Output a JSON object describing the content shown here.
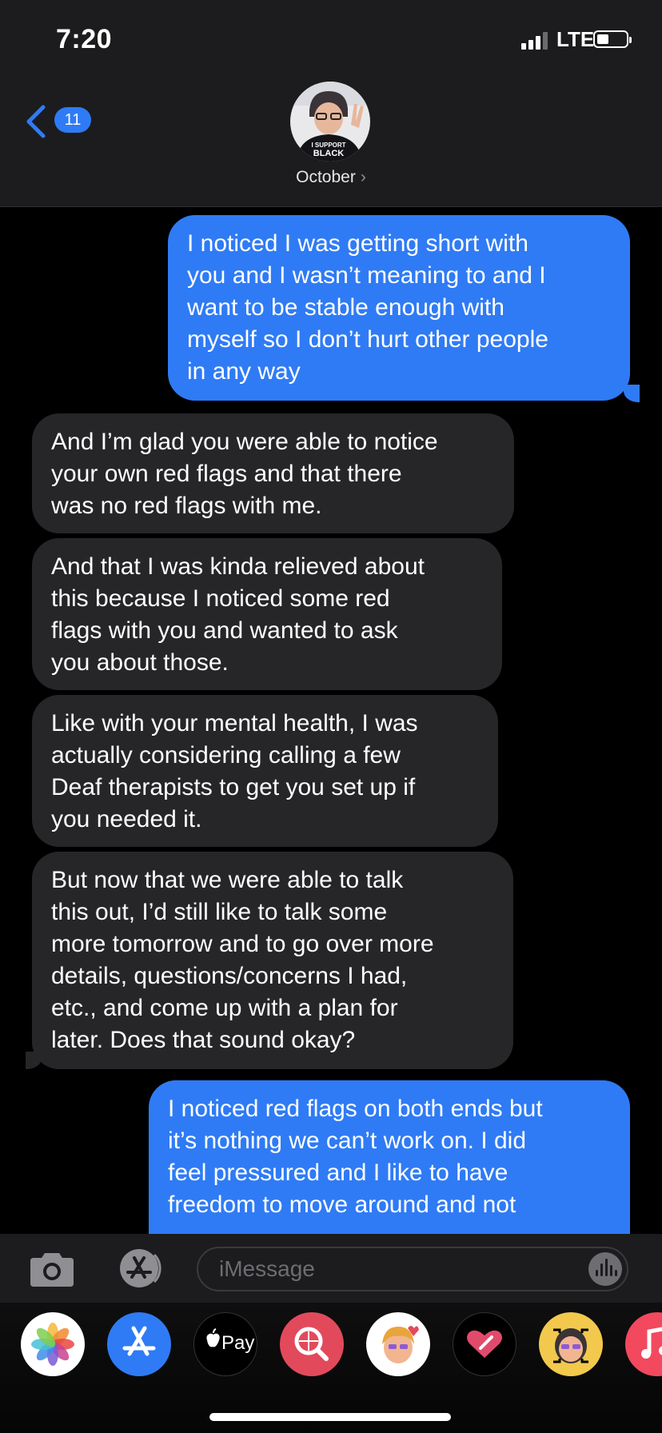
{
  "status_bar": {
    "time": "7:20",
    "network": "LTE",
    "signal_bars": 3,
    "signal_total": 4,
    "battery_level_percent": 30
  },
  "nav": {
    "back_count": "11",
    "contact_name": "October",
    "chevron": "›",
    "avatar_icon": "contact-photo",
    "avatar_shirt_text": "I SUPPORT BLACK"
  },
  "messages": [
    {
      "direction": "outgoing",
      "lines": [
        "I noticed I was getting short with",
        "you and I wasn’t meaning to and I",
        "want to be stable enough with",
        "myself so I don’t hurt other people",
        "in any way"
      ]
    },
    {
      "direction": "incoming",
      "lines": [
        "And I’m glad you were able to notice",
        "your own red flags and that there",
        "was no red flags with me."
      ]
    },
    {
      "direction": "incoming",
      "lines": [
        "And that I was kinda relieved about",
        "this because I noticed some red",
        "flags with you and wanted to ask",
        "you about those."
      ]
    },
    {
      "direction": "incoming",
      "lines": [
        "Like with your mental health, I was",
        "actually considering calling a few",
        "Deaf therapists to get you set up if",
        "you needed it."
      ]
    },
    {
      "direction": "incoming",
      "lines": [
        "But now that we were able to talk",
        "this out, I’d still like to talk some",
        "more tomorrow and to go over more",
        "details, questions/concerns I had,",
        "etc., and come up with a plan for",
        "later. Does that sound okay?"
      ]
    },
    {
      "direction": "outgoing",
      "lines": [
        "I noticed red flags on both ends but",
        "it’s nothing we can’t work on. I did",
        "feel pressured and I like to have",
        "freedom to move around and not"
      ]
    }
  ],
  "composer": {
    "placeholder": "iMessage",
    "camera_icon": "camera-icon",
    "apps_icon": "app-store-icon",
    "audio_icon": "waveform-icon"
  },
  "app_drawer": {
    "apps": [
      {
        "name": "photos-app-icon"
      },
      {
        "name": "app-store-app-icon"
      },
      {
        "name": "apple-pay-app-icon",
        "label": "Pay"
      },
      {
        "name": "web-search-app-icon"
      },
      {
        "name": "memoji-stickers-app-icon"
      },
      {
        "name": "digital-touch-app-icon"
      },
      {
        "name": "animoji-app-icon"
      },
      {
        "name": "music-app-icon"
      }
    ]
  },
  "colors": {
    "outgoing_bubble": "#2f7bf5",
    "incoming_bubble": "#262628",
    "background": "#000000",
    "bar": "#1c1c1e"
  }
}
